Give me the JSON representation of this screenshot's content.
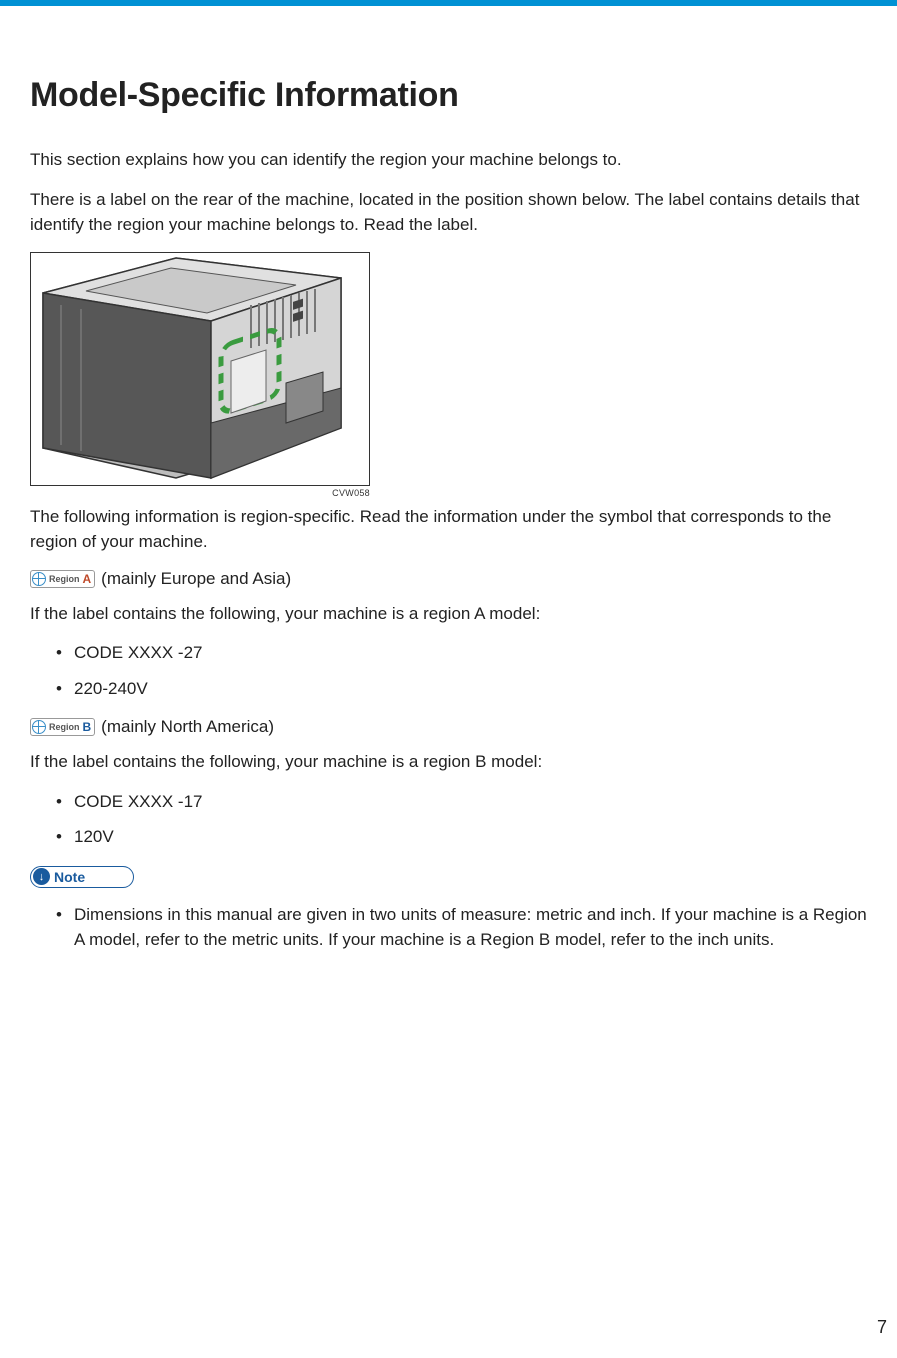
{
  "heading": "Model-Specific Information",
  "intro1": "This section explains how you can identify the region your machine belongs to.",
  "intro2": "There is a label on the rear of the machine, located in the position shown below. The label contains details that identify the region your machine belongs to. Read the label.",
  "figure_caption": "CVW058",
  "para_after_fig": "The following information is region-specific. Read the information under the symbol that corresponds to the region of your machine.",
  "region_a": {
    "badge_label": "Region",
    "letter": "A",
    "desc": "(mainly Europe and Asia)",
    "para": "If the label contains the following, your machine is a region A model:",
    "items": [
      "CODE XXXX -27",
      "220-240V"
    ]
  },
  "region_b": {
    "badge_label": "Region",
    "letter": "B",
    "desc": "(mainly North America)",
    "para": "If the label contains the following, your machine is a region B model:",
    "items": [
      "CODE XXXX -17",
      "120V"
    ]
  },
  "note": {
    "label": "Note",
    "items": [
      "Dimensions in this manual are given in two units of measure: metric and inch. If your machine is a Region A model, refer to the metric units. If your machine is a Region B model, refer to the inch units."
    ]
  },
  "page_number": "7"
}
